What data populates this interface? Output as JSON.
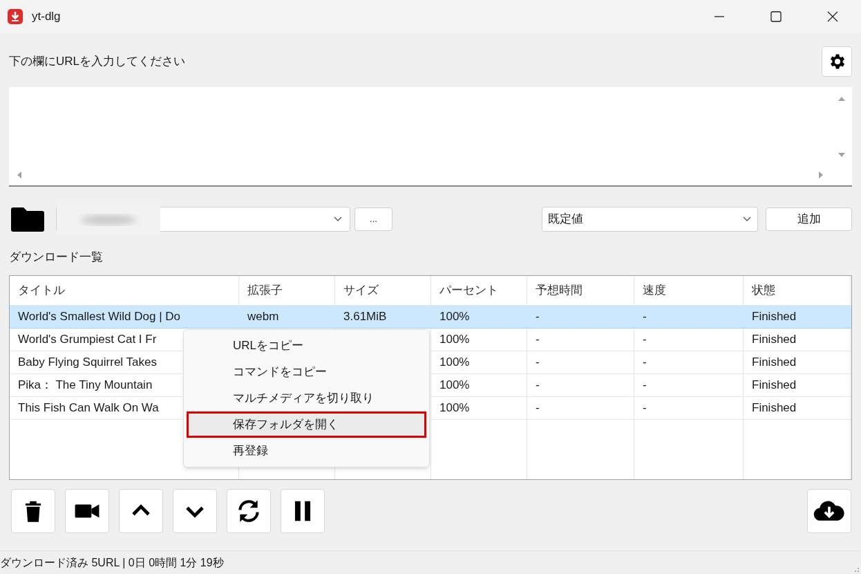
{
  "window": {
    "title": "yt-dlg"
  },
  "url_label": "下の欄にURLを入力してください",
  "path_row": {
    "browse_button": "...",
    "preset": "既定値",
    "add_button": "追加"
  },
  "list_label": "ダウンロード一覧",
  "table": {
    "columns": [
      "タイトル",
      "拡張子",
      "サイズ",
      "パーセント",
      "予想時間",
      "速度",
      "状態"
    ],
    "rows": [
      {
        "selected": true,
        "cells": [
          "World's Smallest Wild Dog | Do",
          "webm",
          "3.61MiB",
          "100%",
          "-",
          "-",
          "Finished"
        ]
      },
      {
        "selected": false,
        "cells": [
          "World's Grumpiest Cat I Fr",
          "",
          "",
          "100%",
          "-",
          "-",
          "Finished"
        ]
      },
      {
        "selected": false,
        "cells": [
          "Baby Flying Squirrel Takes",
          "",
          "",
          "100%",
          "-",
          "-",
          "Finished"
        ]
      },
      {
        "selected": false,
        "cells": [
          "Pika： The Tiny Mountain",
          "",
          "",
          "100%",
          "-",
          "-",
          "Finished"
        ]
      },
      {
        "selected": false,
        "cells": [
          "This Fish Can Walk On Wa",
          "",
          "",
          "100%",
          "-",
          "-",
          "Finished"
        ]
      }
    ]
  },
  "context_menu": [
    {
      "label": "URLをコピー",
      "selected": false
    },
    {
      "label": "コマンドをコピー",
      "selected": false
    },
    {
      "label": "マルチメディアを切り取り",
      "selected": false
    },
    {
      "label": "保存フォルダを開く",
      "selected": true
    },
    {
      "label": "再登録",
      "selected": false
    }
  ],
  "toolbar": [
    {
      "kind": "delete"
    },
    {
      "kind": "video"
    },
    {
      "kind": "up"
    },
    {
      "kind": "down"
    },
    {
      "kind": "reload"
    },
    {
      "kind": "pause"
    }
  ],
  "status_bar": "ダウンロード済み 5URL | 0日 0時間 1分 19秒"
}
